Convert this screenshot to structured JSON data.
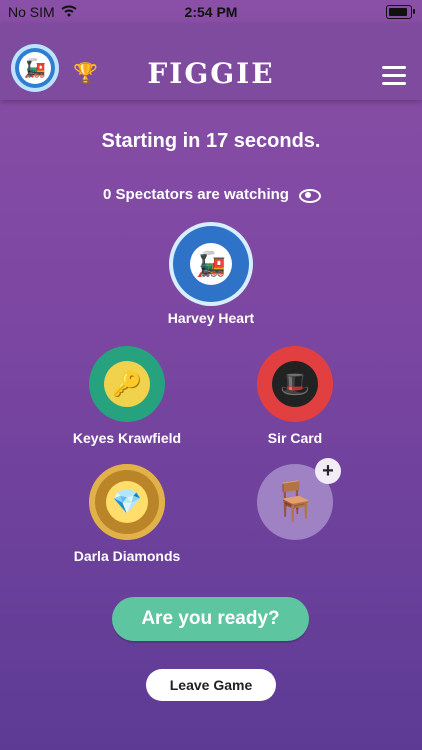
{
  "status_bar": {
    "carrier": "No SIM",
    "time": "2:54 PM"
  },
  "header": {
    "app_name": "FIGGIE",
    "profile_icon": "train-avatar-icon",
    "trophy_icon": "trophy-icon",
    "menu_icon": "hamburger-menu-icon"
  },
  "main": {
    "countdown_text": "Starting in 17 seconds.",
    "spectators_text": "0 Spectators are watching",
    "players": [
      {
        "name": "Harvey Heart",
        "icon": "train-icon"
      },
      {
        "name": "Keyes Krawfield",
        "icon": "key-icon"
      },
      {
        "name": "Sir Card",
        "icon": "top-hat-icon"
      },
      {
        "name": "Darla Diamonds",
        "icon": "diamond-icon"
      }
    ],
    "empty_seat_icon": "chair-add-icon",
    "ready_button": "Are you ready?",
    "leave_button": "Leave Game"
  },
  "colors": {
    "background_top": "#8a4fa6",
    "background_bottom": "#5d3b95",
    "ready_button": "#5ec5a1",
    "blue_avatar": "#2f73c8",
    "green_avatar": "#26a27f",
    "red_avatar": "#e24040",
    "gold_avatar": "#b98528"
  }
}
